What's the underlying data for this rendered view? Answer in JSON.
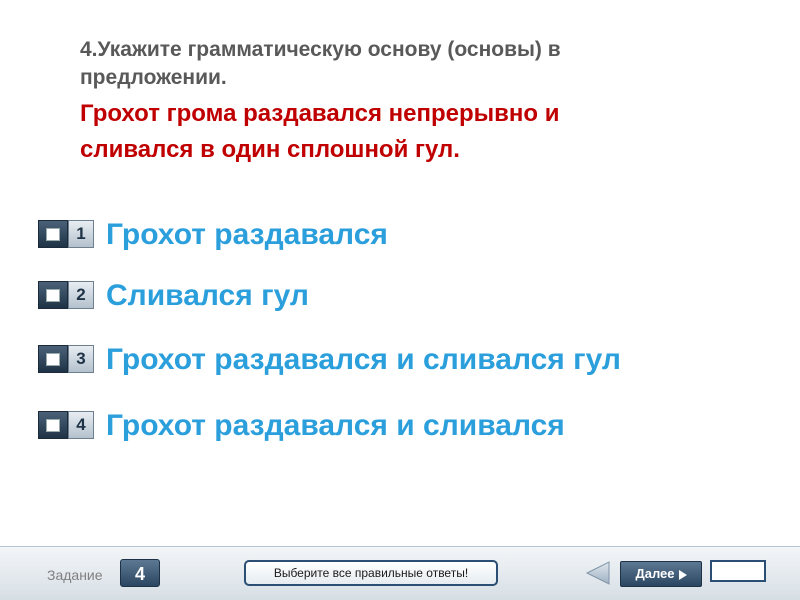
{
  "question": {
    "instruction": "4.Укажите грамматическую основу (основы) в\nпредложении.",
    "sentence": "Грохот грома раздавался непрерывно и\nсливался в один сплошной гул."
  },
  "options": [
    {
      "number": "1",
      "text": "Грохот раздавался"
    },
    {
      "number": "2",
      "text": "Сливался гул"
    },
    {
      "number": "3",
      "text": "Грохот раздавался и сливался гул"
    },
    {
      "number": "4",
      "text": "Грохот раздавался и сливался"
    }
  ],
  "footer": {
    "task_label": "Задание",
    "task_number": "4",
    "hint": "Выберите все правильные ответы!",
    "next_label": "Далее",
    "answer_value": ""
  },
  "icons": {
    "back": "back-arrow-icon",
    "next": "play-triangle-icon",
    "checkbox": "checkbox-icon"
  },
  "colors": {
    "instruction": "#595959",
    "sentence": "#c00000",
    "options": "#2b9fdc",
    "navy": "#2b4661"
  }
}
